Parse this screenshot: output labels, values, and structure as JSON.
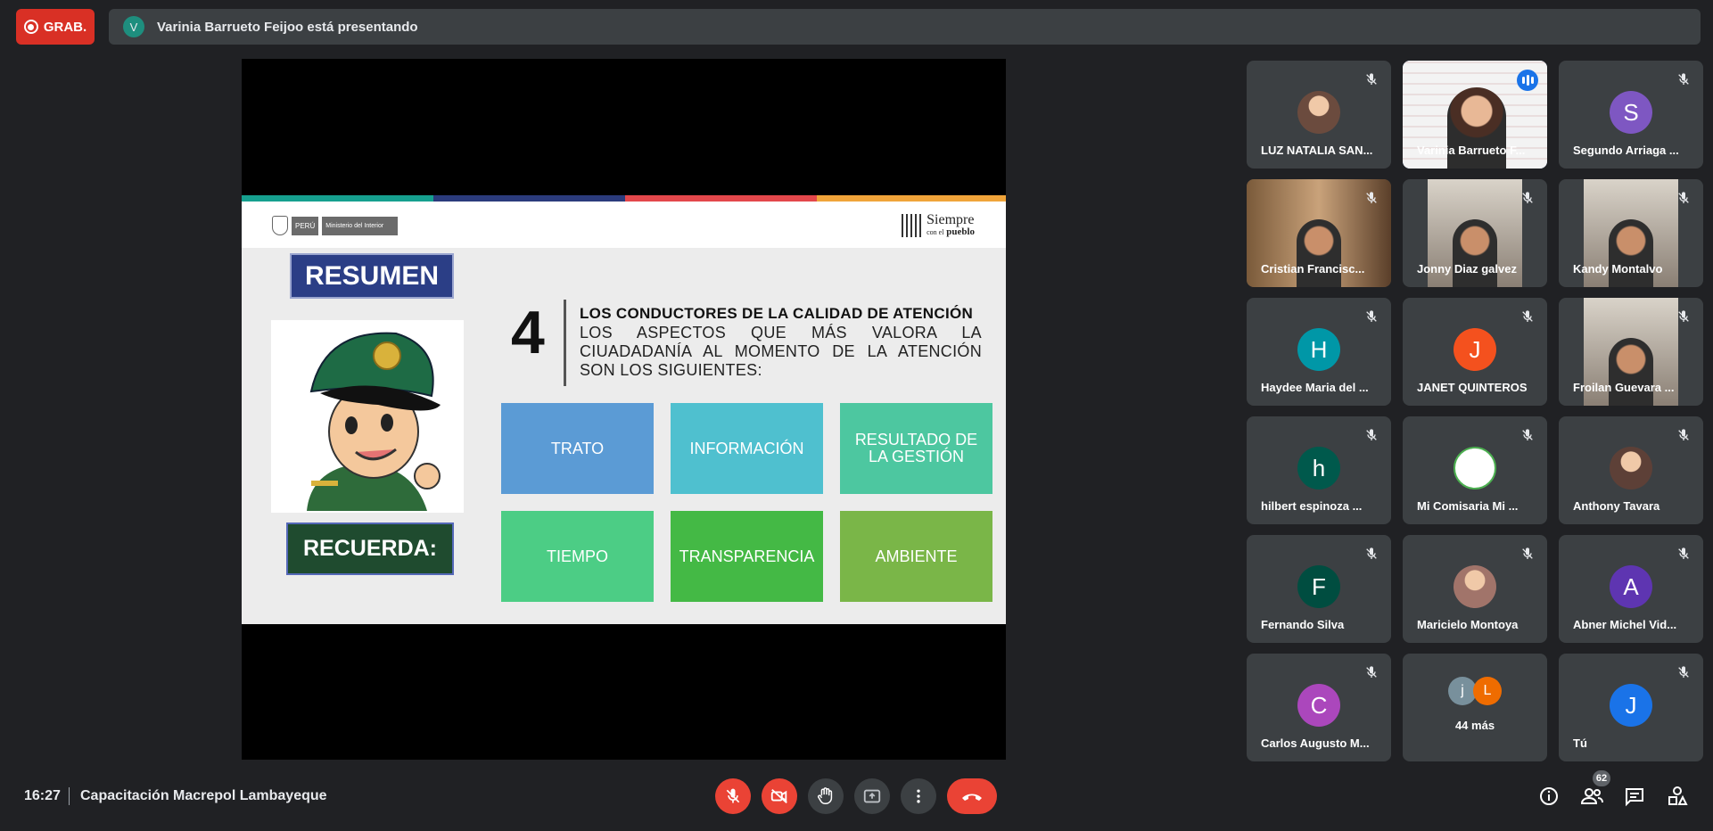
{
  "recording": {
    "label": "GRAB."
  },
  "presenting": {
    "initial": "V",
    "text": "Varinia Barrueto Feijoo está presentando"
  },
  "slide": {
    "org_left": "PERÚ",
    "org_right": "Ministerio del Interior",
    "brand_line1": "Siempre",
    "brand_line2_a": "con el",
    "brand_line2_b": "pueblo",
    "resumen": "RESUMEN",
    "recuerda": "RECUERDA:",
    "number": "4",
    "heading": "LOS CONDUCTORES DE LA CALIDAD DE ATENCIÓN",
    "description": "LOS ASPECTOS QUE MÁS VALORA LA CIUADADANÍA AL MOMENTO DE LA ATENCIÓN SON LOS SIGUIENTES:",
    "boxes": [
      "TRATO",
      "INFORMACIÓN",
      "RESULTADO DE LA GESTIÓN",
      "TIEMPO",
      "TRANSPARENCIA",
      "AMBIENTE"
    ],
    "box_colors": [
      "#5b9bd5",
      "#4fc0cf",
      "#4dc7a0",
      "#4ccd85",
      "#44b945",
      "#7ab648"
    ],
    "stripe_colors": [
      "#16a08f",
      "#2b3b7c",
      "#e3474b",
      "#f0a43a"
    ]
  },
  "participants": [
    {
      "name": "LUZ NATALIA SAN...",
      "type": "photo",
      "color": "#6b4b3e"
    },
    {
      "name": "Varinia Barrueto F...",
      "type": "video",
      "speaking": true
    },
    {
      "name": "Segundo Arriaga ...",
      "type": "initial",
      "initial": "S",
      "color": "#7e57c2"
    },
    {
      "name": "Cristian Francisc...",
      "type": "video"
    },
    {
      "name": "Jonny Diaz galvez",
      "type": "video"
    },
    {
      "name": "Kandy Montalvo",
      "type": "video"
    },
    {
      "name": "Haydee Maria del ...",
      "type": "initial",
      "initial": "H",
      "color": "#0097a7"
    },
    {
      "name": "JANET QUINTEROS",
      "type": "initial",
      "initial": "J",
      "color": "#f4511e"
    },
    {
      "name": "Froilan Guevara ...",
      "type": "video"
    },
    {
      "name": "hilbert espinoza ...",
      "type": "initial",
      "initial": "h",
      "color": "#00594c"
    },
    {
      "name": "Mi Comisaria Mi ...",
      "type": "logo",
      "color": "#ffffff"
    },
    {
      "name": "Anthony Tavara",
      "type": "photo",
      "color": "#5d4037"
    },
    {
      "name": "Fernando Silva",
      "type": "initial",
      "initial": "F",
      "color": "#004d40"
    },
    {
      "name": "Maricielo Montoya",
      "type": "photo",
      "color": "#a1746a"
    },
    {
      "name": "Abner Michel Vid...",
      "type": "initial",
      "initial": "A",
      "color": "#5e35b1"
    },
    {
      "name": "Carlos Augusto M...",
      "type": "initial",
      "initial": "C",
      "color": "#ab47bc"
    },
    {
      "name": "44 más",
      "type": "more",
      "initials": [
        "j",
        "L"
      ],
      "colors": [
        "#78909c",
        "#ef6c00"
      ]
    },
    {
      "name": "Tú",
      "type": "initial",
      "initial": "J",
      "color": "#1a73e8"
    }
  ],
  "bottom": {
    "time": "16:27",
    "meeting": "Capacitación Macrepol Lambayeque",
    "participant_count": "62"
  }
}
